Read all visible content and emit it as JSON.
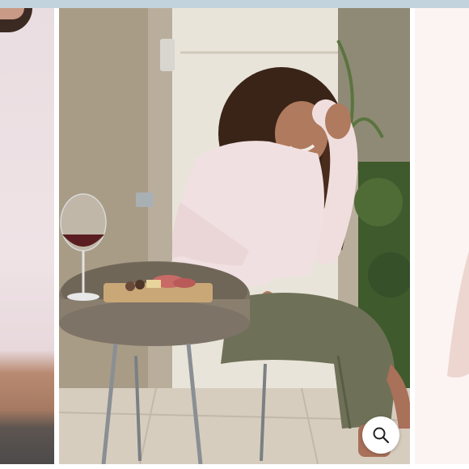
{
  "carousel": {
    "slides": [
      {
        "name": "previous-slide-partial"
      },
      {
        "name": "current-slide",
        "scene": "woman-in-pink-top-at-bistro-table"
      },
      {
        "name": "next-slide-partial"
      }
    ],
    "zoom_button": {
      "icon": "search-icon"
    }
  },
  "colors": {
    "top_bar": "#c3d3dd",
    "top_tint": "#efe0e4",
    "pants_olive": "#6e7157",
    "table_stone": "#7d7366",
    "background": "#ffffff"
  }
}
